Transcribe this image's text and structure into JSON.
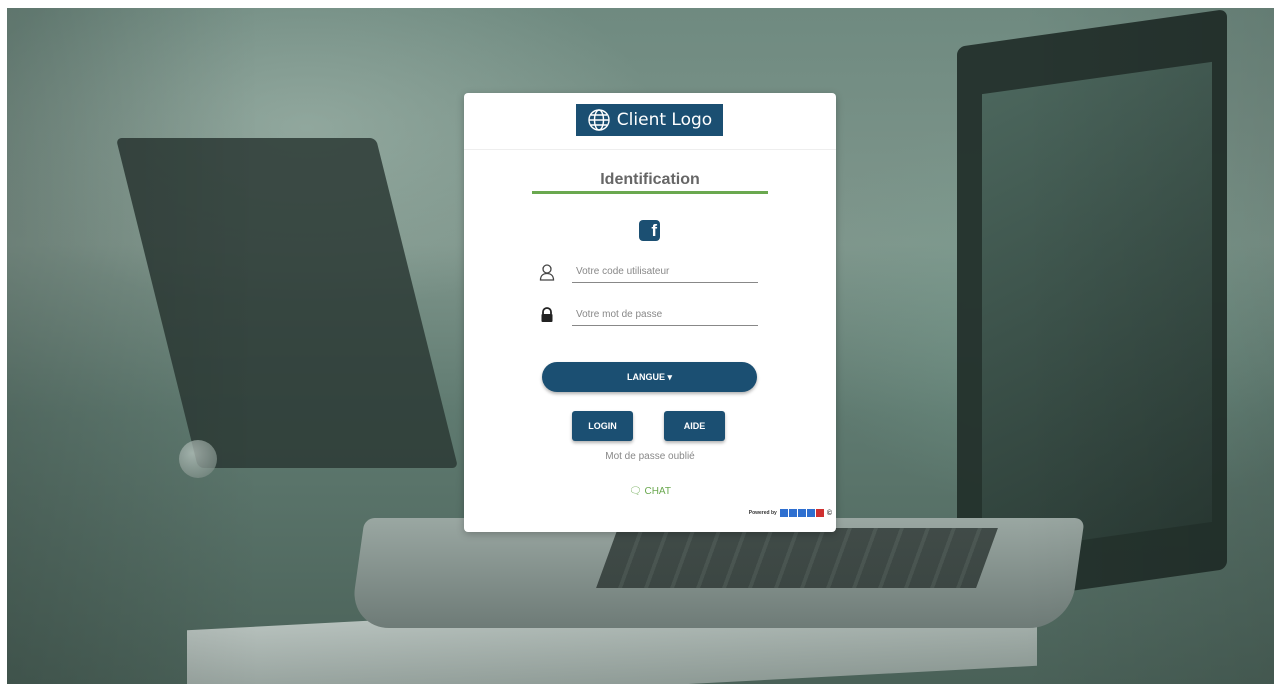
{
  "logo": {
    "text": "Client Logo",
    "icon": "globe-icon"
  },
  "form": {
    "title": "Identification",
    "social_icon": "facebook-icon",
    "social_glyph": "f",
    "username": {
      "placeholder": "Votre code utilisateur",
      "icon": "user-icon"
    },
    "password": {
      "placeholder": "Votre mot de passe",
      "icon": "lock-icon"
    },
    "language_button": "LANGUE ▾",
    "login_button": "LOGIN",
    "help_button": "AIDE",
    "forgot_password": "Mot de passe oublié",
    "chat": "🗨 CHAT"
  },
  "footer": {
    "powered_by": "Powered by",
    "copyright": "©"
  },
  "colors": {
    "primary": "#1b4f72",
    "accent": "#6aa84f"
  }
}
